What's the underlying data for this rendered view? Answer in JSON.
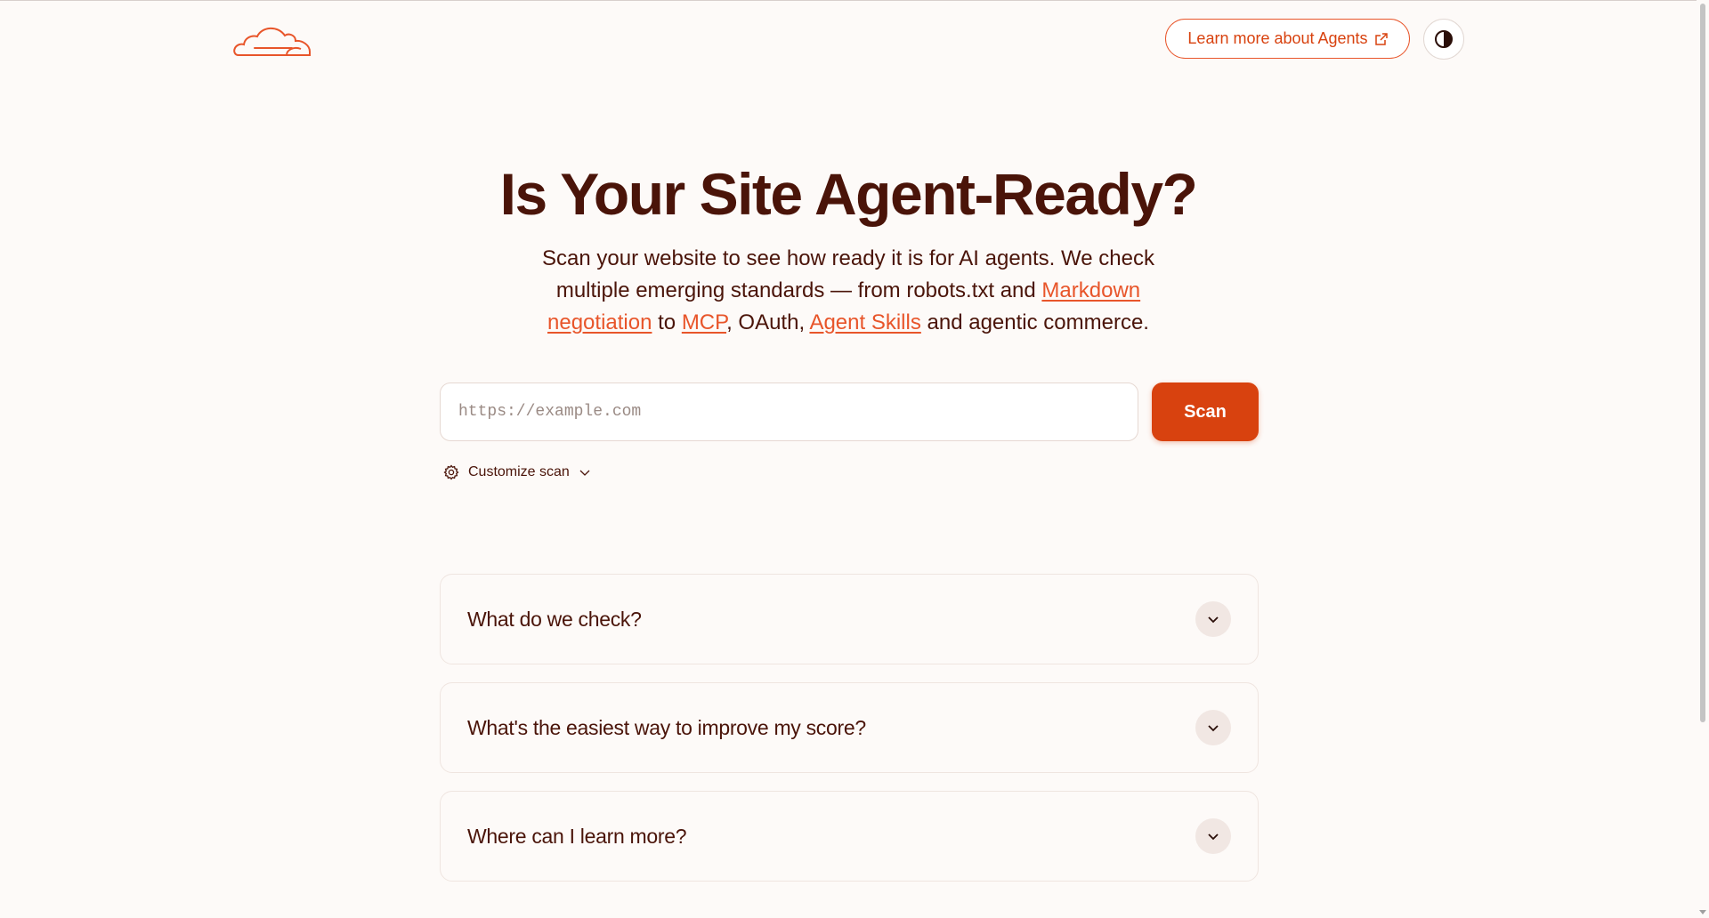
{
  "header": {
    "learn_label": "Learn more about Agents",
    "logo_icon": "cloudflare-cloud-icon",
    "theme_icon": "contrast-icon"
  },
  "hero": {
    "title": "Is Your Site Agent-Ready?",
    "subtitle_part1": "Scan your website to see how ready it is for AI agents. We check multiple emerging standards — from robots.txt and ",
    "link_markdown": "Markdown negotiation",
    "subtitle_part2": " to ",
    "link_mcp": "MCP",
    "subtitle_part3": ", OAuth, ",
    "link_skills": "Agent Skills",
    "subtitle_part4": " and agentic commerce."
  },
  "search": {
    "placeholder": "https://example.com",
    "value": "",
    "scan_label": "Scan",
    "customize_label": "Customize scan"
  },
  "faq": [
    {
      "question": "What do we check?"
    },
    {
      "question": "What's the easiest way to improve my score?"
    },
    {
      "question": "Where can I learn more?"
    }
  ],
  "colors": {
    "accent": "#d8420f",
    "link": "#e8552a",
    "text": "#4a1409",
    "background": "#fdfaf8"
  }
}
